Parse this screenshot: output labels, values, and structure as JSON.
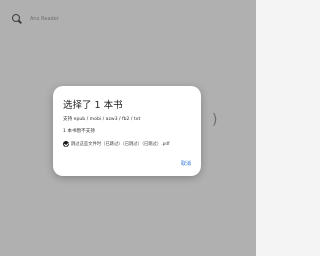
{
  "search": {
    "placeholder": "Anx Reader"
  },
  "background": {
    "fragment": ")"
  },
  "dialog": {
    "title": "选择了 1 本书",
    "formats": "支持 epub / mobi / azw3 / fb2 / txt",
    "unsupported": "1 本书暂不支持",
    "skip_label": "跳过这些文件时（已跳过）（已跳过）（已跳过）.pdf",
    "skip_checked": true,
    "cancel_label": "取消"
  }
}
